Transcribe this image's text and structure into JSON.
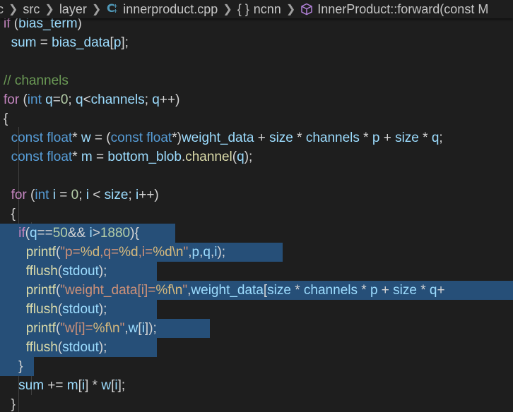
{
  "breadcrumb": {
    "lead": "c",
    "src": "src",
    "layer": "layer",
    "file": "innerproduct.cpp",
    "ns_symbol": "{ }",
    "ns": "ncnn",
    "method": "InnerProduct::forward(const M"
  },
  "code": [
    [
      [
        "ctl",
        "if"
      ],
      [
        "txt",
        " ("
      ],
      [
        "var",
        "bias_term"
      ],
      [
        "txt",
        ")"
      ]
    ],
    [
      [
        "txt",
        "  "
      ],
      [
        "var",
        "sum"
      ],
      [
        "txt",
        " = "
      ],
      [
        "var",
        "bias_data"
      ],
      [
        "txt",
        "["
      ],
      [
        "var",
        "p"
      ],
      [
        "txt",
        "];"
      ]
    ],
    [],
    [
      [
        "cmt",
        "// channels"
      ]
    ],
    [
      [
        "ctl",
        "for"
      ],
      [
        "txt",
        " ("
      ],
      [
        "kw",
        "int"
      ],
      [
        "txt",
        " "
      ],
      [
        "var",
        "q"
      ],
      [
        "txt",
        "="
      ],
      [
        "num",
        "0"
      ],
      [
        "txt",
        "; "
      ],
      [
        "var",
        "q"
      ],
      [
        "txt",
        "<"
      ],
      [
        "var",
        "channels"
      ],
      [
        "txt",
        "; "
      ],
      [
        "var",
        "q"
      ],
      [
        "txt",
        "++)"
      ]
    ],
    [
      [
        "txt",
        "{"
      ]
    ],
    [
      [
        "txt",
        "  "
      ],
      [
        "kw",
        "const"
      ],
      [
        "txt",
        " "
      ],
      [
        "kw",
        "float"
      ],
      [
        "txt",
        "* "
      ],
      [
        "var",
        "w"
      ],
      [
        "txt",
        " = ("
      ],
      [
        "kw",
        "const"
      ],
      [
        "txt",
        " "
      ],
      [
        "kw",
        "float"
      ],
      [
        "txt",
        "*)"
      ],
      [
        "var",
        "weight_data"
      ],
      [
        "txt",
        " + "
      ],
      [
        "var",
        "size"
      ],
      [
        "txt",
        " * "
      ],
      [
        "var",
        "channels"
      ],
      [
        "txt",
        " * "
      ],
      [
        "var",
        "p"
      ],
      [
        "txt",
        " + "
      ],
      [
        "var",
        "size"
      ],
      [
        "txt",
        " * "
      ],
      [
        "var",
        "q"
      ],
      [
        "txt",
        ";"
      ]
    ],
    [
      [
        "txt",
        "  "
      ],
      [
        "kw",
        "const"
      ],
      [
        "txt",
        " "
      ],
      [
        "kw",
        "float"
      ],
      [
        "txt",
        "* "
      ],
      [
        "var",
        "m"
      ],
      [
        "txt",
        " = "
      ],
      [
        "var",
        "bottom_blob"
      ],
      [
        "txt",
        "."
      ],
      [
        "fn",
        "channel"
      ],
      [
        "txt",
        "("
      ],
      [
        "var",
        "q"
      ],
      [
        "txt",
        ");"
      ]
    ],
    [],
    [
      [
        "txt",
        "  "
      ],
      [
        "ctl",
        "for"
      ],
      [
        "txt",
        " ("
      ],
      [
        "kw",
        "int"
      ],
      [
        "txt",
        " "
      ],
      [
        "var",
        "i"
      ],
      [
        "txt",
        " = "
      ],
      [
        "num",
        "0"
      ],
      [
        "txt",
        "; "
      ],
      [
        "var",
        "i"
      ],
      [
        "txt",
        " < "
      ],
      [
        "var",
        "size"
      ],
      [
        "txt",
        "; "
      ],
      [
        "var",
        "i"
      ],
      [
        "txt",
        "++)"
      ]
    ],
    [
      [
        "txt",
        "  {"
      ]
    ],
    [
      [
        "txt",
        "    "
      ],
      [
        "ctl",
        "if"
      ],
      [
        "txt",
        "("
      ],
      [
        "var",
        "q"
      ],
      [
        "txt",
        "=="
      ],
      [
        "num",
        "50"
      ],
      [
        "txt",
        "&& "
      ],
      [
        "var",
        "i"
      ],
      [
        "txt",
        ">"
      ],
      [
        "num",
        "1880"
      ],
      [
        "txt",
        "){"
      ]
    ],
    [
      [
        "txt",
        "      "
      ],
      [
        "fn",
        "printf"
      ],
      [
        "txt",
        "("
      ],
      [
        "str",
        "\"p="
      ],
      [
        "esc",
        "%d"
      ],
      [
        "str",
        ",q="
      ],
      [
        "esc",
        "%d"
      ],
      [
        "str",
        ",i="
      ],
      [
        "esc",
        "%d\\n"
      ],
      [
        "str",
        "\""
      ],
      [
        "txt",
        ","
      ],
      [
        "var",
        "p"
      ],
      [
        "txt",
        ","
      ],
      [
        "var",
        "q"
      ],
      [
        "txt",
        ","
      ],
      [
        "var",
        "i"
      ],
      [
        "txt",
        ");"
      ]
    ],
    [
      [
        "txt",
        "      "
      ],
      [
        "fn",
        "fflush"
      ],
      [
        "txt",
        "("
      ],
      [
        "var",
        "stdout"
      ],
      [
        "txt",
        ");"
      ]
    ],
    [
      [
        "txt",
        "      "
      ],
      [
        "fn",
        "printf"
      ],
      [
        "txt",
        "("
      ],
      [
        "str",
        "\"weight_data[i]="
      ],
      [
        "esc",
        "%f\\n"
      ],
      [
        "str",
        "\""
      ],
      [
        "txt",
        ","
      ],
      [
        "var",
        "weight_data"
      ],
      [
        "txt",
        "["
      ],
      [
        "var",
        "size"
      ],
      [
        "txt",
        " * "
      ],
      [
        "var",
        "channels"
      ],
      [
        "txt",
        " * "
      ],
      [
        "var",
        "p"
      ],
      [
        "txt",
        " + "
      ],
      [
        "var",
        "size"
      ],
      [
        "txt",
        " * "
      ],
      [
        "var",
        "q"
      ],
      [
        "txt",
        "+"
      ]
    ],
    [
      [
        "txt",
        "      "
      ],
      [
        "fn",
        "fflush"
      ],
      [
        "txt",
        "("
      ],
      [
        "var",
        "stdout"
      ],
      [
        "txt",
        ");"
      ]
    ],
    [
      [
        "txt",
        "      "
      ],
      [
        "fn",
        "printf"
      ],
      [
        "txt",
        "("
      ],
      [
        "str",
        "\"w[i]="
      ],
      [
        "esc",
        "%f\\n"
      ],
      [
        "str",
        "\""
      ],
      [
        "txt",
        ","
      ],
      [
        "var",
        "w"
      ],
      [
        "txt",
        "["
      ],
      [
        "var",
        "i"
      ],
      [
        "txt",
        "]);"
      ]
    ],
    [
      [
        "txt",
        "      "
      ],
      [
        "fn",
        "fflush"
      ],
      [
        "txt",
        "("
      ],
      [
        "var",
        "stdout"
      ],
      [
        "txt",
        ");"
      ]
    ],
    [
      [
        "txt",
        "    }"
      ]
    ],
    [
      [
        "txt",
        "    "
      ],
      [
        "var",
        "sum"
      ],
      [
        "txt",
        " += "
      ],
      [
        "var",
        "m"
      ],
      [
        "txt",
        "["
      ],
      [
        "var",
        "i"
      ],
      [
        "txt",
        "] * "
      ],
      [
        "var",
        "w"
      ],
      [
        "txt",
        "["
      ],
      [
        "var",
        "i"
      ],
      [
        "txt",
        "];"
      ]
    ],
    [
      [
        "txt",
        "  }"
      ]
    ]
  ],
  "colors": {
    "background": "#1e1e1e",
    "selection": "#264f78",
    "keyword": "#569cd6",
    "control": "#c586c0",
    "variable": "#9cdcfe",
    "function": "#dcdcaa",
    "number": "#b5cea8",
    "string": "#ce9178",
    "comment": "#6a9955"
  }
}
